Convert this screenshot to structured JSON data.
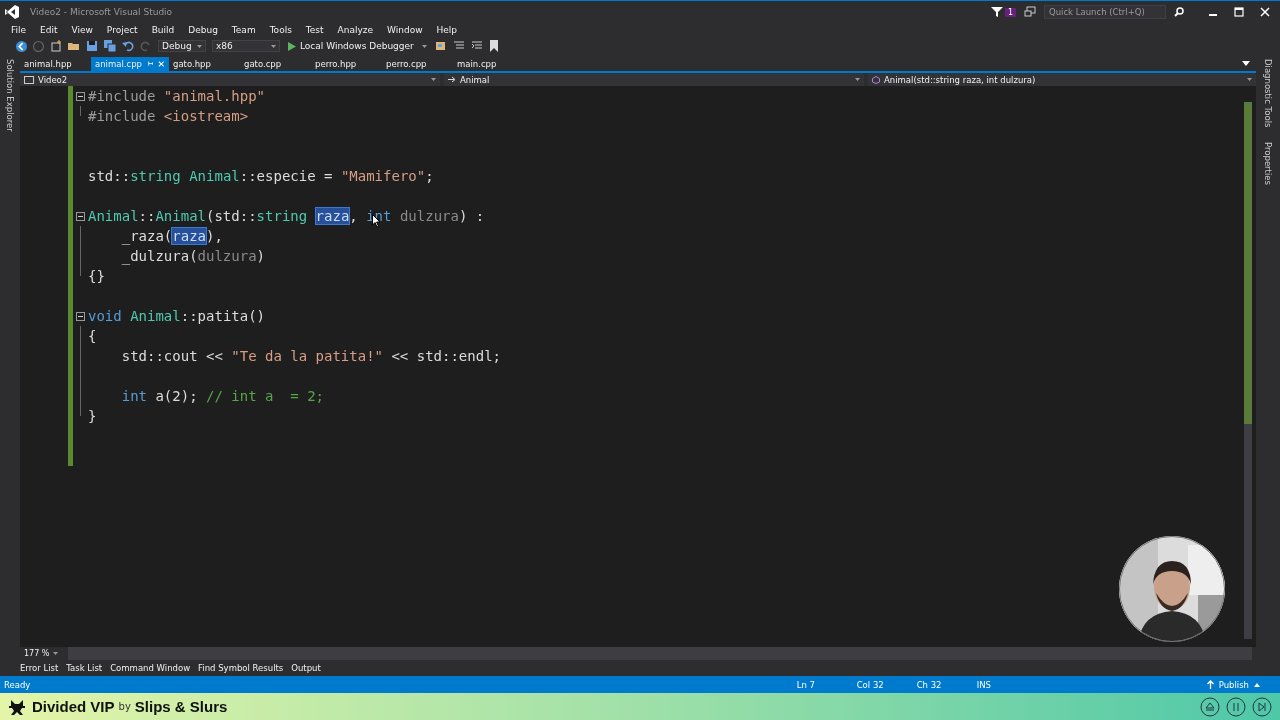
{
  "window": {
    "title": "Video2 - Microsoft Visual Studio",
    "notification_count": "1",
    "quick_launch": {
      "placeholder": "Quick Launch (Ctrl+Q)"
    }
  },
  "menu": [
    "File",
    "Edit",
    "View",
    "Project",
    "Build",
    "Debug",
    "Team",
    "Tools",
    "Test",
    "Analyze",
    "Window",
    "Help"
  ],
  "toolbar": {
    "configuration": "Debug",
    "platform": "x86",
    "debugger": "Local Windows Debugger"
  },
  "tabs": [
    {
      "label": "animal.hpp",
      "selected": false
    },
    {
      "label": "animal.cpp",
      "selected": true
    },
    {
      "label": "gato.hpp",
      "selected": false
    },
    {
      "label": "gato.cpp",
      "selected": false
    },
    {
      "label": "perro.hpp",
      "selected": false
    },
    {
      "label": "perro.cpp",
      "selected": false
    },
    {
      "label": "main.cpp",
      "selected": false
    }
  ],
  "navigation_bar": {
    "project": "Video2",
    "scope": "Animal",
    "member": "Animal(std::string raza, int dulzura)"
  },
  "side_panels": {
    "left": [
      "Solution Explorer"
    ],
    "right": [
      "Diagnostic Tools",
      "Properties"
    ]
  },
  "editor": {
    "lines": [
      {
        "kind": "fold_start",
        "tokens": [
          {
            "kind": "pre",
            "text": "#include "
          },
          {
            "kind": "str",
            "text": "\"animal.hpp\""
          }
        ]
      },
      {
        "kind": "fold_end",
        "tokens": [
          {
            "kind": "pre",
            "text": "#include "
          },
          {
            "kind": "str",
            "text": "<iostream>"
          }
        ]
      },
      {
        "kind": "plain"
      },
      {
        "kind": "plain"
      },
      {
        "kind": "plain",
        "tokens": [
          {
            "kind": "plain",
            "text": "std::"
          },
          {
            "kind": "type",
            "text": "string"
          },
          {
            "kind": "type",
            "text": " Animal"
          },
          {
            "kind": "plain",
            "text": "::especie = "
          },
          {
            "kind": "str",
            "text": "\"Mamifero\""
          },
          {
            "kind": "plain",
            "text": ";"
          }
        ]
      },
      {
        "kind": "plain"
      },
      {
        "kind": "fold_start",
        "tokens": [
          {
            "kind": "type",
            "text": "Animal"
          },
          {
            "kind": "plain",
            "text": "::"
          },
          {
            "kind": "type",
            "text": "Animal"
          },
          {
            "kind": "plain",
            "text": "(std::"
          },
          {
            "kind": "type",
            "text": "string "
          },
          {
            "kind": "param_hl",
            "text": "raza"
          },
          {
            "kind": "plain",
            "text": ", "
          },
          {
            "kind": "kw",
            "text": "int"
          },
          {
            "kind": "param",
            "text": " dulzura"
          },
          {
            "kind": "plain",
            "text": ") :"
          }
        ]
      },
      {
        "kind": "fold_line",
        "tokens": [
          {
            "kind": "plain",
            "text": "    _raza("
          },
          {
            "kind": "param_hl",
            "text": "raza"
          },
          {
            "kind": "plain",
            "text": "),"
          }
        ]
      },
      {
        "kind": "fold_line",
        "tokens": [
          {
            "kind": "plain",
            "text": "    _dulzura("
          },
          {
            "kind": "param",
            "text": "dulzura"
          },
          {
            "kind": "plain",
            "text": ")"
          }
        ]
      },
      {
        "kind": "fold_end",
        "tokens": [
          {
            "kind": "plain",
            "text": "{}"
          }
        ]
      },
      {
        "kind": "plain"
      },
      {
        "kind": "fold_start",
        "tokens": [
          {
            "kind": "kw",
            "text": "void"
          },
          {
            "kind": "type",
            "text": " Animal"
          },
          {
            "kind": "plain",
            "text": "::patita()"
          }
        ]
      },
      {
        "kind": "fold_line",
        "tokens": [
          {
            "kind": "plain",
            "text": "{"
          }
        ]
      },
      {
        "kind": "fold_line",
        "tokens": [
          {
            "kind": "plain",
            "text": "    std::cout << "
          },
          {
            "kind": "str",
            "text": "\"Te da la patita!\""
          },
          {
            "kind": "plain",
            "text": " << std::endl;"
          }
        ]
      },
      {
        "kind": "fold_line"
      },
      {
        "kind": "fold_line",
        "tokens": [
          {
            "kind": "kw",
            "text": "    int"
          },
          {
            "kind": "plain",
            "text": " a(2); "
          },
          {
            "kind": "comment",
            "text": "// int a  = 2;"
          }
        ]
      },
      {
        "kind": "fold_end",
        "tokens": [
          {
            "kind": "plain",
            "text": "}"
          }
        ]
      },
      {
        "kind": "plain"
      },
      {
        "kind": "plain"
      }
    ]
  },
  "zoom": "177 %",
  "tool_windows": [
    "Error List",
    "Task List",
    "Command Window",
    "Find Symbol Results",
    "Output"
  ],
  "status_bar": {
    "state": "Ready",
    "line": "Ln 7",
    "column": "Col 32",
    "char": "Ch 32",
    "mode": "INS",
    "publish": "Publish"
  },
  "music_banner": {
    "title": "Divided VIP",
    "by": "by",
    "artist": "Slips & Slurs"
  },
  "webcam": {
    "kind": "picture"
  }
}
